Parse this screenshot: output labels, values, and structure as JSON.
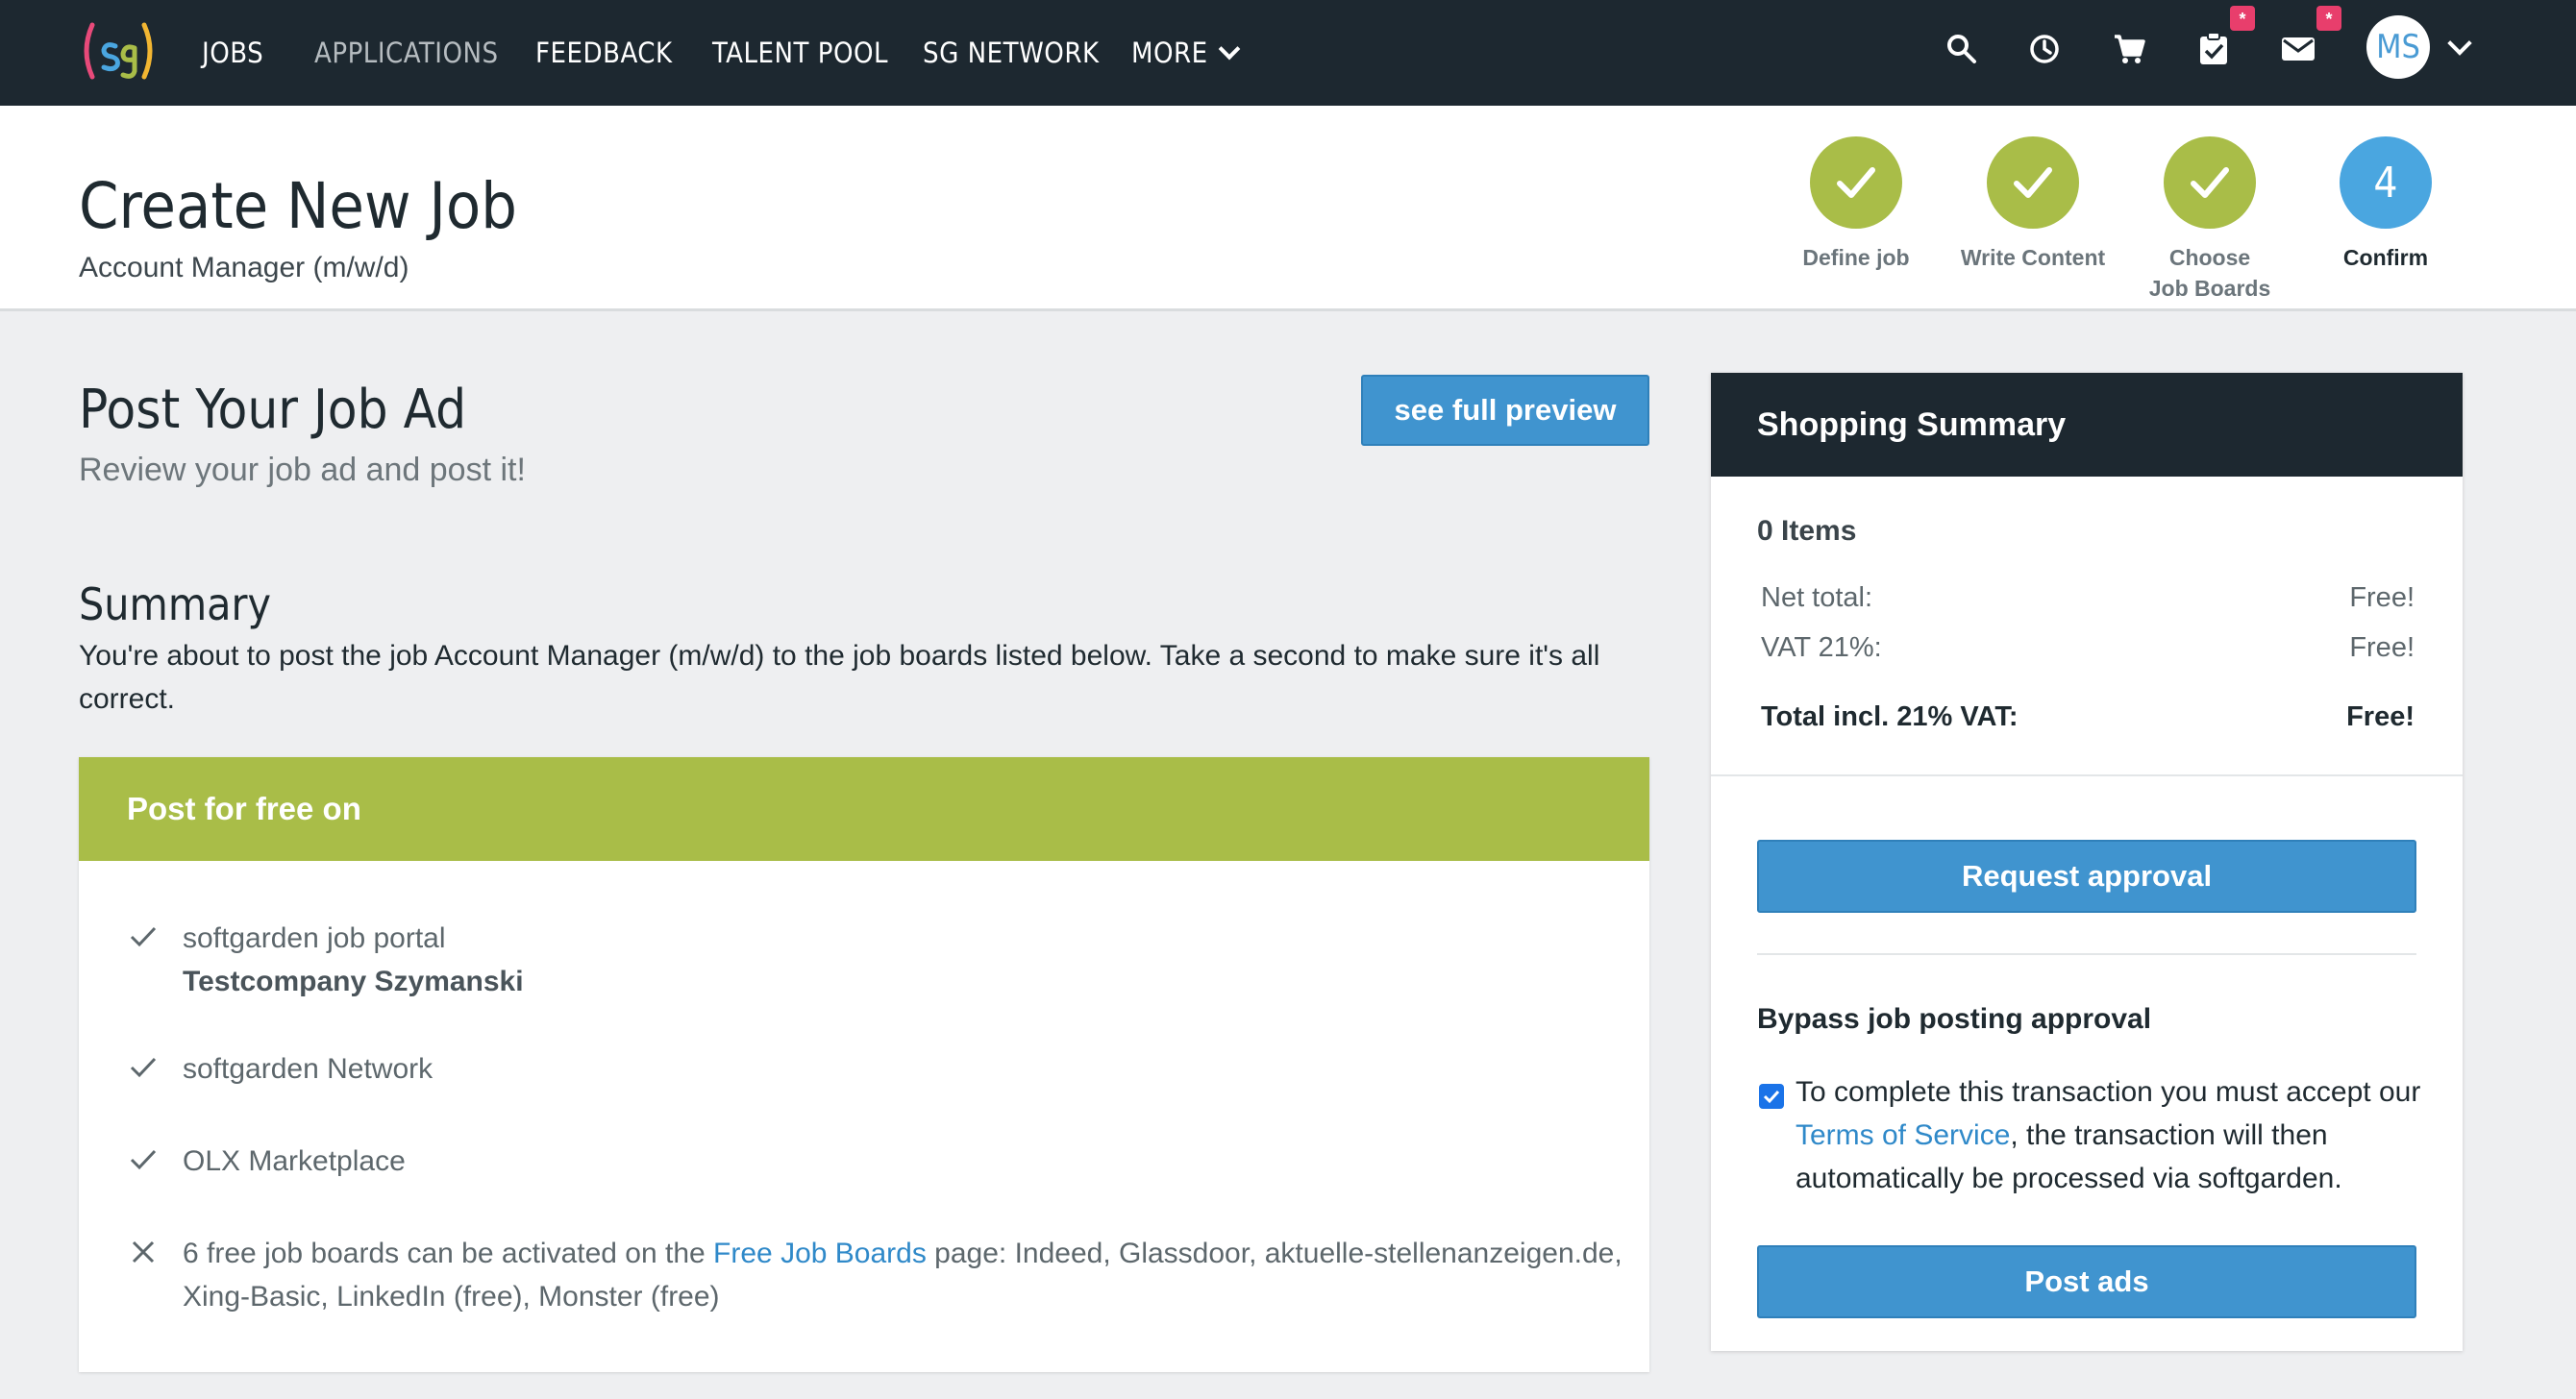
{
  "nav": {
    "items": [
      "JOBS",
      "APPLICATIONS",
      "FEEDBACK",
      "TALENT POOL",
      "SG NETWORK",
      "MORE"
    ],
    "badges": {
      "tasks": "*",
      "messages": "*"
    },
    "avatar_initials": "MS",
    "icons": [
      "search-icon",
      "clock-icon",
      "cart-icon",
      "clipboard-check-icon",
      "mail-icon"
    ]
  },
  "header": {
    "title": "Create New Job",
    "subtitle": "Account Manager (m/w/d)"
  },
  "steps": [
    {
      "label": "Define job",
      "state": "done"
    },
    {
      "label": "Write Content",
      "state": "done"
    },
    {
      "label": "Choose Job Boards",
      "state": "done"
    },
    {
      "label": "Confirm",
      "number": "4",
      "state": "current"
    }
  ],
  "main": {
    "title": "Post Your Job Ad",
    "subtitle": "Review your job ad and post it!",
    "preview_button": "see full preview",
    "summary_title": "Summary",
    "summary_text": "You're about to post the job Account Manager (m/w/d) to the job boards listed below. Take a second to make sure it's all correct."
  },
  "boards": {
    "header": "Post for free on",
    "items": [
      {
        "name": "softgarden job portal",
        "detail": "Testcompany Szymanski",
        "status": "check"
      },
      {
        "name": "softgarden Network",
        "status": "check"
      },
      {
        "name": "OLX Marketplace",
        "status": "check"
      }
    ],
    "inactive": {
      "prefix": "6 free job boards can be activated on the ",
      "link": "Free Job Boards",
      "suffix": " page: Indeed, Glassdoor, aktuelle-stellenanzeigen.de, Xing-Basic, LinkedIn (free), Monster (free)",
      "status": "cross"
    }
  },
  "shop": {
    "title": "Shopping Summary",
    "items_count": "0 Items",
    "net_label": "Net total:",
    "net_value": "Free!",
    "vat_label": "VAT 21%:",
    "vat_value": "Free!",
    "total_label": "Total incl. 21% VAT:",
    "total_value": "Free!",
    "request_button": "Request approval",
    "bypass_title": "Bypass job posting approval",
    "bypass_checked": true,
    "terms_prefix": "To complete this transaction you must accept our ",
    "terms_link": "Terms of Service",
    "terms_suffix": ", the transaction will then automatically be processed via softgarden.",
    "post_button": "Post ads"
  },
  "colors": {
    "nav_bg": "#1d2830",
    "accent_green": "#a9bd48",
    "accent_blue": "#4094cf",
    "step_current": "#4aa6e0",
    "badge": "#e83e6c",
    "link": "#2f89c9"
  }
}
